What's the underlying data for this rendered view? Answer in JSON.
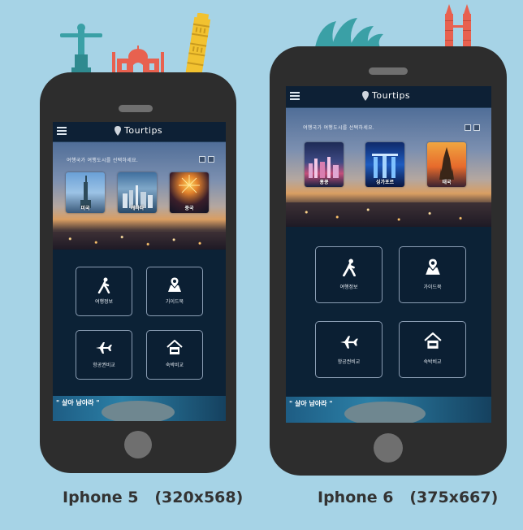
{
  "app": {
    "brand": "Tourtips"
  },
  "hero": {
    "tagline": "여행국가 여행도시를 선택하세요.",
    "cities_p5": [
      {
        "label": "미국",
        "photo": "statue-of-liberty-photo"
      },
      {
        "label": "캐나다",
        "photo": "toronto-skyline-photo"
      },
      {
        "label": "중국",
        "photo": "fireworks-photo"
      }
    ],
    "cities_p6": [
      {
        "label": "홍콩",
        "photo": "hong-kong-night-photo"
      },
      {
        "label": "싱가포르",
        "photo": "marina-bay-photo"
      },
      {
        "label": "태국",
        "photo": "wat-arun-photo"
      }
    ]
  },
  "menu": {
    "items": [
      {
        "label": "여행정보",
        "icon": "walking-person-icon"
      },
      {
        "label": "가이드북",
        "icon": "map-pin-icon"
      },
      {
        "label": "항공권비교",
        "icon": "airplane-icon"
      },
      {
        "label": "숙박비교",
        "icon": "hotel-icon"
      }
    ]
  },
  "banner": {
    "title": "\" 살아 남아라 \""
  },
  "captions": {
    "iphone5": "Iphone 5   (320x568)",
    "iphone6": "Iphone 6   (375x667)"
  },
  "colors": {
    "background": "#a6d3e6",
    "phone": "#2d2d2d",
    "screen": "#0c2236",
    "landmark_red": "#e8614f",
    "landmark_yellow": "#f2c230",
    "landmark_teal": "#3aa0a6"
  }
}
